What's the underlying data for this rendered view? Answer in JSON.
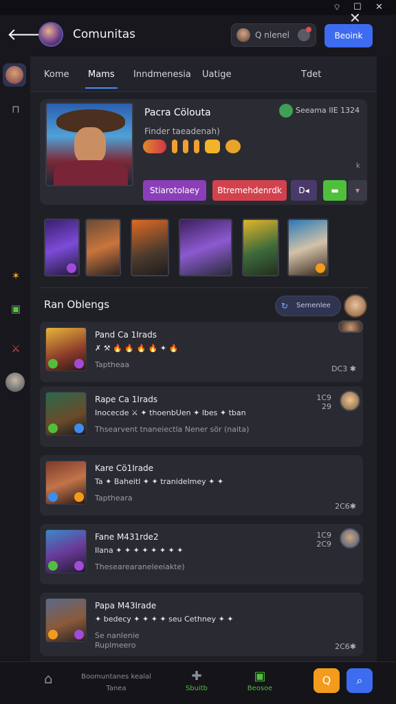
{
  "system": {
    "icons": [
      "wifi-icon",
      "maximize-icon",
      "close-icon"
    ]
  },
  "header": {
    "title": "Comunitas",
    "search_text": "Q nlenel",
    "primary_button": "Beoink"
  },
  "tabs": [
    {
      "label": "Kome"
    },
    {
      "label": "Mams",
      "active": true
    },
    {
      "label": "Inndmenesia"
    },
    {
      "label": "Uatige"
    },
    {
      "label": "Tdet"
    }
  ],
  "profile": {
    "name": "Pacra Cölouta",
    "stat": "Seeama IIE 1324",
    "subtitle": "Finder taeadenah)",
    "flag": "k",
    "buttons": {
      "primary": "Stiarotolaey",
      "secondary": "Btremehdenrdk",
      "third": "D◂"
    }
  },
  "section": {
    "title": "Ran Oblengs",
    "pill_label": "Semenlee"
  },
  "feed": [
    {
      "title": "Pand Ca 1Irads",
      "line": "✗ ⚒ 🔥 🔥 🔥 🔥 ✦ 🔥",
      "sub": "Taptheaa",
      "meta": "DC3 ✱"
    },
    {
      "title": "Rape Ca 1Irads",
      "line": "Inocecde ⚔ ✦ thoenbUen ✦ lbes ✦ tban",
      "sub": "Thsearvent tnaneiectla Nener sör (naita)",
      "meta": "1C9\n29"
    },
    {
      "title": "Kare Cö1Irade",
      "line": "Ta ✦ Baheitl ✦ ✦ tranidelmey ✦ ✦",
      "sub": "Taptheara",
      "meta": "2C6✱"
    },
    {
      "title": "Fane M431rde2",
      "line": "Ilana ✦ ✦ ✦ ✦ ✦ ✦ ✦ ✦",
      "sub": "Thesearearaneleeiakte)",
      "meta": "1C9\n2C9"
    },
    {
      "title": "Papa M43Irade",
      "line": "✦ bedecy ✦ ✦ ✦ ✦ seu Cethney ✦ ✦",
      "sub": "Se nanlenie",
      "sub2": "Ruplmeero",
      "meta": "2C6✱"
    }
  ],
  "bottom_nav": [
    {
      "label": "Boomuntanes kealal",
      "sub": "Tanea"
    },
    {
      "label": "Sbuitb"
    },
    {
      "label": "Beosoe"
    }
  ],
  "colors": {
    "accent": "#3d6cf0",
    "purple": "#8a3fb8",
    "red": "#d2424e",
    "green": "#4fbf3c",
    "orange": "#f29b1d"
  }
}
